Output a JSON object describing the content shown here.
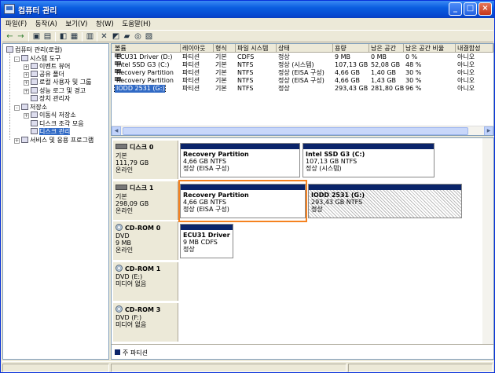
{
  "window": {
    "title": "컴퓨터 관리"
  },
  "menu": [
    "파일(F)",
    "동작(A)",
    "보기(V)",
    "창(W)",
    "도움말(H)"
  ],
  "tree": [
    {
      "label": "컴퓨터 관리(로컬)",
      "icon": "computer-icon",
      "level": 0,
      "expander": ""
    },
    {
      "label": "시스템 도구",
      "icon": "tools-icon",
      "level": 1,
      "expander": "-"
    },
    {
      "label": "이벤트 뷰어",
      "icon": "event-viewer-icon",
      "level": 2,
      "expander": "+"
    },
    {
      "label": "공유 폴더",
      "icon": "shared-folder-icon",
      "level": 2,
      "expander": "+"
    },
    {
      "label": "로컬 사용자 및 그룹",
      "icon": "users-icon",
      "level": 2,
      "expander": "+"
    },
    {
      "label": "성능 로그 및 경고",
      "icon": "performance-icon",
      "level": 2,
      "expander": "+"
    },
    {
      "label": "장치 관리자",
      "icon": "device-manager-icon",
      "level": 2,
      "expander": ""
    },
    {
      "label": "저장소",
      "icon": "storage-icon",
      "level": 1,
      "expander": "-"
    },
    {
      "label": "이동식 저장소",
      "icon": "removable-storage-icon",
      "level": 2,
      "expander": "+"
    },
    {
      "label": "디스크 조각 모음",
      "icon": "defrag-icon",
      "level": 2,
      "expander": ""
    },
    {
      "label": "디스크 관리",
      "icon": "disk-management-icon",
      "level": 2,
      "expander": "",
      "selected": true
    },
    {
      "label": "서비스 및 응용 프로그램",
      "icon": "services-icon",
      "level": 1,
      "expander": "+"
    }
  ],
  "columns": [
    "볼륨",
    "레이아웃",
    "형식",
    "파일 시스템",
    "상태",
    "용량",
    "남은 공간",
    "남은 공간 비율",
    "내결함성"
  ],
  "volumes": [
    {
      "name": "ECU31 Driver (D:)",
      "layout": "파티션",
      "type": "기본",
      "fs": "CDFS",
      "status": "정상",
      "capacity": "9 MB",
      "free": "0 MB",
      "pct": "0 %",
      "fault": "아니오"
    },
    {
      "name": "Intel SSD G3 (C:)",
      "layout": "파티션",
      "type": "기본",
      "fs": "NTFS",
      "status": "정상 (시스템)",
      "capacity": "107,13 GB",
      "free": "52,08 GB",
      "pct": "48 %",
      "fault": "아니오"
    },
    {
      "name": "Recovery Partition",
      "layout": "파티션",
      "type": "기본",
      "fs": "NTFS",
      "status": "정상 (EISA 구성)",
      "capacity": "4,66 GB",
      "free": "1,40 GB",
      "pct": "30 %",
      "fault": "아니오"
    },
    {
      "name": "Recovery Partition",
      "layout": "파티션",
      "type": "기본",
      "fs": "NTFS",
      "status": "정상 (EISA 구성)",
      "capacity": "4,66 GB",
      "free": "1,43 GB",
      "pct": "30 %",
      "fault": "아니오"
    },
    {
      "name": "IODD 2531 (G:)",
      "layout": "파티션",
      "type": "기본",
      "fs": "NTFS",
      "status": "정상",
      "capacity": "293,43 GB",
      "free": "281,80 GB",
      "pct": "96 %",
      "fault": "아니오",
      "selected": true
    }
  ],
  "disks": [
    {
      "name": "디스크 0",
      "kind": "hdd",
      "lines": [
        "기본",
        "111,79 GB",
        "온라인"
      ],
      "partitions": [
        {
          "title": "Recovery Partition",
          "size": "4,66 GB NTFS",
          "status": "정상 (EISA 구성)"
        },
        {
          "title": "Intel SSD G3  (C:)",
          "size": "107,13 GB NTFS",
          "status": "정상 (시스템)"
        }
      ]
    },
    {
      "name": "디스크 1",
      "kind": "hdd",
      "lines": [
        "기본",
        "298,09 GB",
        "온라인"
      ],
      "partitions": [
        {
          "title": "Recovery Partition",
          "size": "4,66 GB NTFS",
          "status": "정상 (EISA 구성)"
        },
        {
          "title": "IODD 2531  (G:)",
          "size": "293,43 GB NTFS",
          "status": "정상"
        }
      ]
    },
    {
      "name": "CD-ROM 0",
      "kind": "cd",
      "lines": [
        "DVD",
        "9 MB",
        "온라인"
      ],
      "partitions": [
        {
          "title": "ECU31 Driver",
          "size": "9 MB CDFS",
          "status": "정상"
        }
      ]
    },
    {
      "name": "CD-ROM 1",
      "kind": "cd",
      "lines": [
        "DVD (E:)",
        "",
        "미디어 없음"
      ],
      "partitions": []
    },
    {
      "name": "CD-ROM 3",
      "kind": "cd",
      "lines": [
        "DVD (F:)",
        "",
        "미디어 없음"
      ],
      "partitions": []
    }
  ],
  "legend": {
    "primary": "주 파티션"
  }
}
